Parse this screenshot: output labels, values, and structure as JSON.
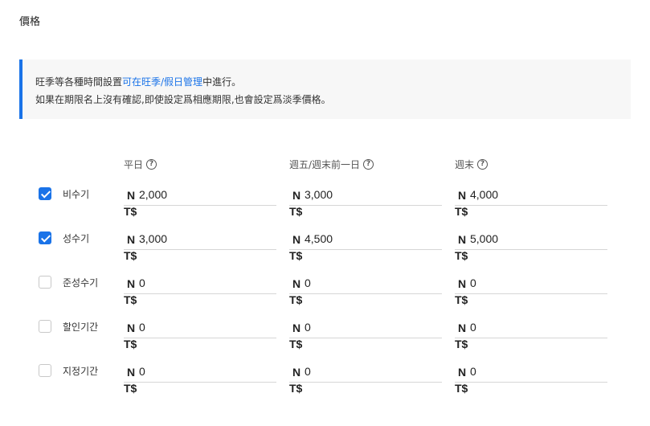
{
  "page_title": "價格",
  "notice": {
    "line1_before": "旺季等各種時間設置",
    "line1_link": "可在旺季/假日管理",
    "line1_after": "中進行。",
    "line2": "如果在期限名上沒有確認,即使設定爲相應期限,也會設定爲淡季價格。"
  },
  "columns": [
    {
      "label": "平日",
      "icon": "question-circle-icon"
    },
    {
      "label": "週五/週末前一日",
      "icon": "question-circle-icon"
    },
    {
      "label": "週末",
      "icon": "question-circle-icon"
    }
  ],
  "currency_symbol": "N",
  "currency_code": "T$",
  "accent_color": "#1a73e8",
  "rows": [
    {
      "label": "비수기",
      "checked": true,
      "prices": [
        "2,000",
        "3,000",
        "4,000"
      ]
    },
    {
      "label": "성수기",
      "checked": true,
      "prices": [
        "3,000",
        "4,500",
        "5,000"
      ]
    },
    {
      "label": "준성수기",
      "checked": false,
      "prices": [
        "0",
        "0",
        "0"
      ]
    },
    {
      "label": "할인기간",
      "checked": false,
      "prices": [
        "0",
        "0",
        "0"
      ]
    },
    {
      "label": "지정기간",
      "checked": false,
      "prices": [
        "0",
        "0",
        "0"
      ]
    }
  ]
}
